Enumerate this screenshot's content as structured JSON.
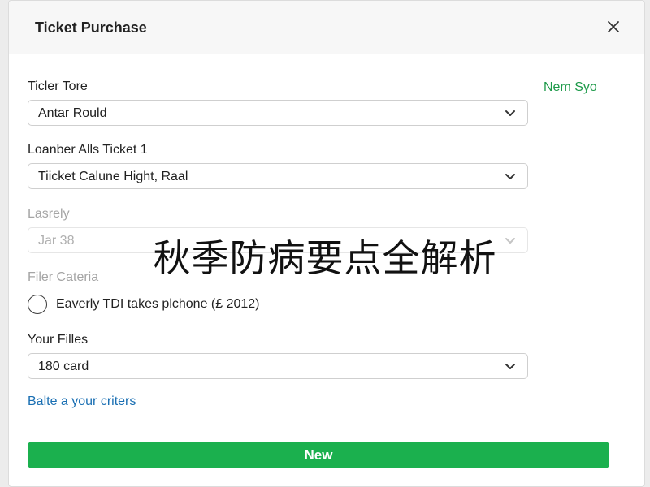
{
  "dialog": {
    "title": "Ticket Purchase",
    "close_icon": "close-icon"
  },
  "side_link": {
    "label": "Nem Syo",
    "color": "#1e9a4a"
  },
  "fields": {
    "ticket_tore": {
      "label": "Ticler Tore",
      "value": "Antar Rould"
    },
    "loanber": {
      "label": "Loanber Alls Ticket 1",
      "value": "Tiicket Calune Hight, Raal"
    },
    "lasrely": {
      "label": "Lasrely",
      "value": "Jar 38",
      "disabled": true
    },
    "filter": {
      "label": "Filer Cateria"
    },
    "your_filles": {
      "label": "Your Filles",
      "value": "180 card"
    }
  },
  "radio": {
    "label": "Eaverly TDI takes plchone (£ 2012)",
    "checked": false
  },
  "link": {
    "label": "Balte a your criters",
    "color": "#1a6fb3"
  },
  "primary_button": {
    "label": "New",
    "color": "#1bb04e"
  },
  "watermark": {
    "text": "秋季防病要点全解析"
  },
  "icons": {
    "dropdown": "chevron-down-icon",
    "close": "close-icon"
  }
}
